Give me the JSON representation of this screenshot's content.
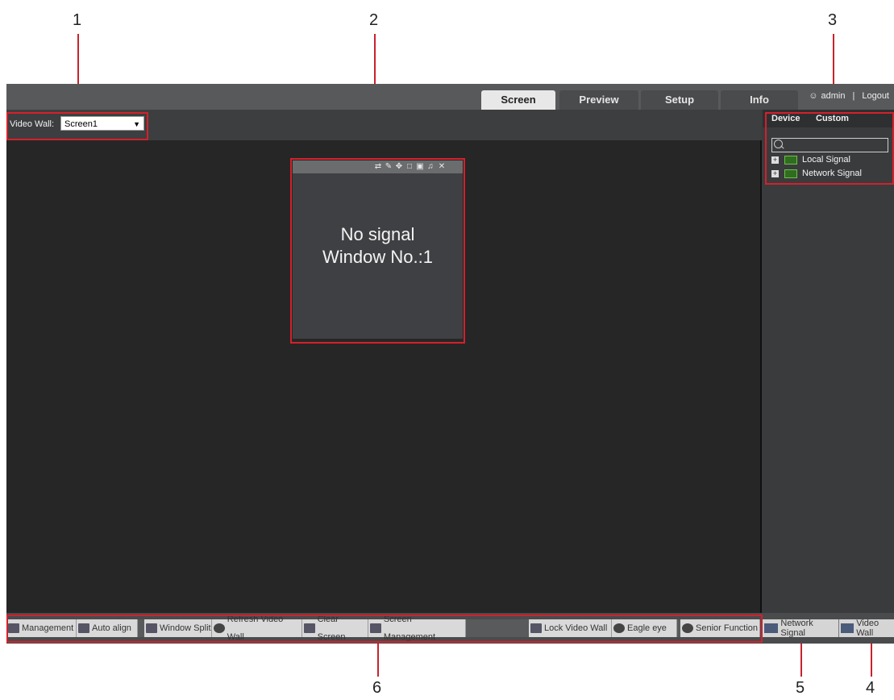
{
  "callouts": [
    "1",
    "2",
    "3",
    "6",
    "5",
    "4"
  ],
  "topbar": {
    "tabs": [
      {
        "label": "Screen",
        "active": true
      },
      {
        "label": "Preview",
        "active": false
      },
      {
        "label": "Setup",
        "active": false
      },
      {
        "label": "Info",
        "active": false
      }
    ],
    "user": "admin",
    "logout": "Logout",
    "separator": "|"
  },
  "video_wall": {
    "label": "Video Wall:",
    "selected": "Screen1"
  },
  "window": {
    "line1": "No signal",
    "line2": "Window No.:1",
    "icons": [
      "swap-icon",
      "edit-icon",
      "move-icon",
      "maximize-icon",
      "lock-icon",
      "audio-icon",
      "close-icon"
    ]
  },
  "right_panel": {
    "tabs": [
      "Device",
      "Custom"
    ],
    "search_placeholder": "",
    "tree": [
      {
        "label": "Local Signal"
      },
      {
        "label": "Network Signal"
      }
    ]
  },
  "toolbar": {
    "left": [
      {
        "label": "Management",
        "icon": "management-icon"
      },
      {
        "label": "Auto align",
        "icon": "auto-align-icon"
      },
      {
        "label": "Window Split",
        "icon": "window-split-icon"
      },
      {
        "label": "Refresh Video Wall",
        "icon": "refresh-icon"
      },
      {
        "label": "Clear Screen",
        "icon": "clear-screen-icon"
      },
      {
        "label": "Screen Management",
        "icon": "monitor-icon"
      }
    ],
    "right": [
      {
        "label": "Lock Video Wall",
        "icon": "lock-wall-icon"
      },
      {
        "label": "Eagle eye",
        "icon": "location-pin-icon"
      },
      {
        "label": "Senior Function",
        "icon": "gear-icon"
      }
    ]
  },
  "panel_tabs": [
    {
      "label": "Network Signal",
      "icon": "network-signal-icon"
    },
    {
      "label": "Video Wall",
      "icon": "video-wall-icon"
    }
  ]
}
